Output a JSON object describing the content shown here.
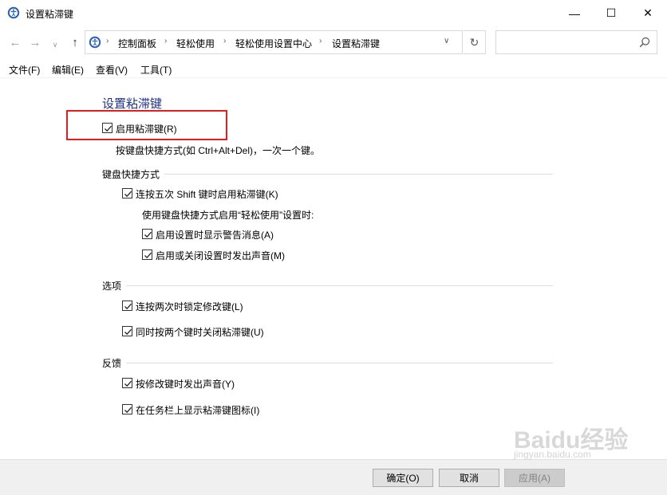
{
  "window": {
    "title": "设置粘滞键",
    "min": "—",
    "max": "☐",
    "close": "✕"
  },
  "nav": {
    "back": "←",
    "forward": "→",
    "history": "∨",
    "up": "↑",
    "breadcrumbs": [
      "控制面板",
      "轻松使用",
      "轻松使用设置中心",
      "设置粘滞键"
    ],
    "separator": "›",
    "dropdown": "∨",
    "refresh": "↻",
    "search_placeholder": ""
  },
  "menu": [
    "文件(F)",
    "编辑(E)",
    "查看(V)",
    "工具(T)"
  ],
  "main": {
    "heading": "设置粘滞键",
    "enable": {
      "label": "启用粘滞键(R)",
      "checked": true
    },
    "enable_desc": "按键盘快捷方式(如 Ctrl+Alt+Del)，一次一个键。",
    "groups": {
      "shortcut": {
        "title": "键盘快捷方式",
        "shift5": {
          "label": "连按五次 Shift 键时启用粘滞键(K)",
          "checked": true
        },
        "subtitle": "使用键盘快捷方式启用“轻松使用”设置时:",
        "warn": {
          "label": "启用设置时显示警告消息(A)",
          "checked": true
        },
        "sound": {
          "label": "启用或关闭设置时发出声音(M)",
          "checked": true
        }
      },
      "options": {
        "title": "选项",
        "lock": {
          "label": "连按两次时锁定修改键(L)",
          "checked": true
        },
        "turnoff": {
          "label": "同时按两个键时关闭粘滞键(U)",
          "checked": true
        }
      },
      "feedback": {
        "title": "反馈",
        "beep": {
          "label": "按修改键时发出声音(Y)",
          "checked": true
        },
        "taskbar": {
          "label": "在任务栏上显示粘滞键图标(I)",
          "checked": true
        }
      }
    }
  },
  "buttons": {
    "ok": "确定(O)",
    "cancel": "取消",
    "apply": "应用(A)"
  },
  "watermark": {
    "main": "Baidu经验",
    "sub": "jingyan.baidu.com"
  },
  "colors": {
    "heading": "#1e3287",
    "highlight": "#e21d1d"
  }
}
